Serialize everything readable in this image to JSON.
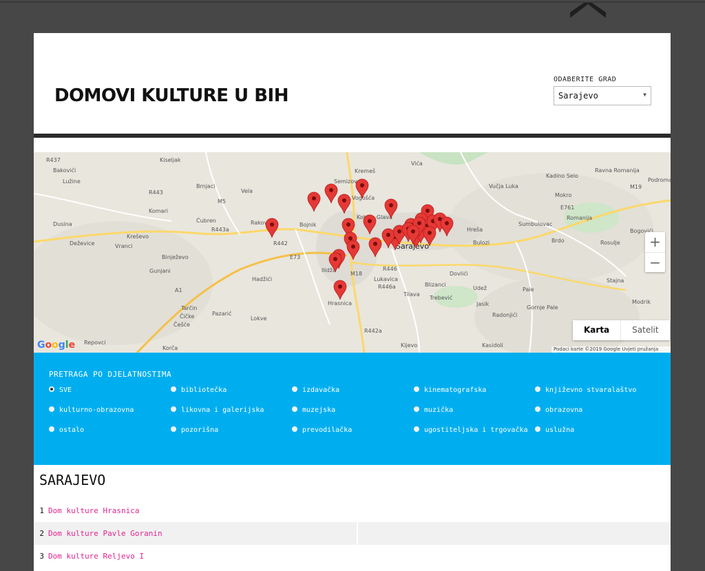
{
  "header": {
    "title": "DOMOVI KULTURE U BIH",
    "city_label": "ODABERITE GRAD",
    "city_value": "Sarajevo"
  },
  "map": {
    "place_labels": [
      "R437",
      "Kiseljak",
      "Bakovići",
      "Lužine",
      "R443",
      "Brnjaci",
      "Komari",
      "Vela",
      "Kremeš",
      "Semizovac",
      "Vogošća",
      "Vića",
      "Vučja Luka",
      "Kadino Selo",
      "Ravna Romanija",
      "Podroma",
      "Mokro",
      "M19",
      "E761",
      "Romanija",
      "Dusina",
      "Ćubren",
      "R443a",
      "Rakovica",
      "Kreševo",
      "Deževice",
      "Vranci",
      "Bojnik",
      "Kobilja Glava",
      "Sarajevo",
      "Hreša",
      "Sumbulovac",
      "Brdo",
      "Bogovići",
      "Rosulje",
      "Binježevo",
      "R442",
      "E73",
      "M5",
      "M18",
      "R446",
      "Ilidža",
      "Hadžići",
      "Bulozi",
      "Dovlići",
      "Blizanci",
      "Stajna",
      "Gunjani",
      "A1",
      "Lukavica",
      "Udež",
      "Tilava",
      "Trebević",
      "Jasik",
      "Pale",
      "Modrik",
      "Gornje Pale",
      "Tarčin",
      "Čičke",
      "Češće",
      "Pazarić",
      "Lokve",
      "Hrasnica",
      "R446a",
      "Radonjići",
      "Kijevo",
      "Kasidoli",
      "Repovci",
      "Korča",
      "R442a"
    ],
    "zoom_in": "+",
    "zoom_out": "−",
    "type_map": "Karta",
    "type_satellite": "Satelit",
    "logo": "Google",
    "attribution": "Podaci karte ©2019 Google    Uvjeti pružanja usluge"
  },
  "filters": {
    "title": "PRETRAGA PO DJELATNOSTIMA",
    "options": [
      "SVE",
      "bibliotečka",
      "izdavačka",
      "kinematografska",
      "književno stvaralaštvo",
      "kulturno-obrazovna",
      "likovna i galerijska",
      "muzejska",
      "muzička",
      "obrazovna",
      "ostalo",
      "pozorišna",
      "prevodilačka",
      "ugostiteljska i trgovačka",
      "uslužna"
    ],
    "selected": "SVE"
  },
  "list": {
    "heading": "SARAJEVO",
    "items": [
      {
        "num": "1",
        "name": "Dom kulture Hrasnica"
      },
      {
        "num": "2",
        "name": "Dom kulture Pavle Goranin"
      },
      {
        "num": "3",
        "name": "Dom kulture Reljevo I"
      }
    ]
  },
  "colors": {
    "filter_bg": "#00aeef",
    "link": "#e2248f",
    "marker": "#e53935",
    "backdrop": "#474747"
  }
}
